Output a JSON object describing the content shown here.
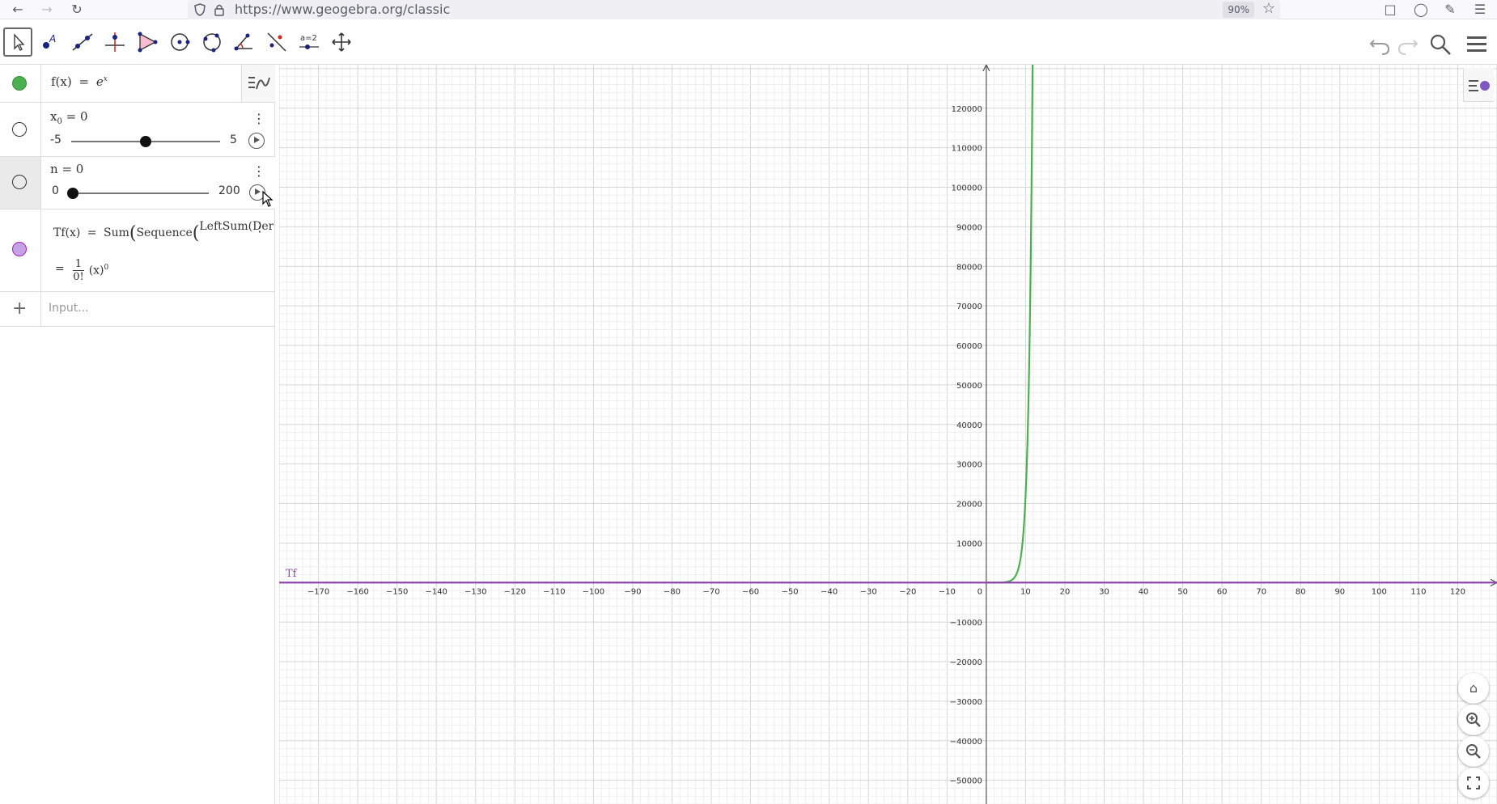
{
  "browser": {
    "url": "https://www.geogebra.org/classic",
    "zoom": "90%"
  },
  "toolbar": {
    "tools": [
      "move-tool",
      "point-tool",
      "line-tool",
      "perpendicular-tool",
      "polygon-tool",
      "circle-tool",
      "conic-tool",
      "angle-tool",
      "reflect-tool",
      "slider-tool",
      "move-graphics-tool"
    ],
    "slider_tool_label": "a=2"
  },
  "algebra": {
    "rows": [
      {
        "marble_color": "#4caf50",
        "name": "f(x)",
        "eq": "=",
        "base": "e",
        "exponent": "x"
      },
      {
        "var": "x",
        "sub": "0",
        "eq": "= 0",
        "min": "-5",
        "max": "5",
        "value": 0,
        "range": [
          -5,
          5
        ]
      },
      {
        "var": "n",
        "eq": "= 0",
        "min": "0",
        "max": "200",
        "value": 0,
        "range": [
          0,
          200
        ]
      },
      {
        "marble_color": "#c8a2e8",
        "name": "Tf(x)",
        "eq": "=",
        "fn1": "Sum",
        "fn2": "Sequence",
        "fn3": "LeftSum(Deriva",
        "eq2": "=",
        "num": "1",
        "den": "0!",
        "rest": "(x)",
        "rest_exp": "0"
      }
    ],
    "input_placeholder": "Input..."
  },
  "chart_data": {
    "type": "line",
    "x_ticks": [
      -170,
      -160,
      -150,
      -140,
      -130,
      -120,
      -110,
      -100,
      -90,
      -80,
      -70,
      -60,
      -50,
      -40,
      -30,
      -20,
      -10,
      0,
      10,
      20,
      30,
      40,
      50,
      60,
      70,
      80,
      90,
      100,
      110,
      120
    ],
    "y_ticks": [
      120000,
      110000,
      100000,
      90000,
      80000,
      70000,
      60000,
      50000,
      40000,
      30000,
      20000,
      10000,
      -10000,
      -20000,
      -30000,
      -40000,
      -50000
    ],
    "xlim": [
      -180,
      130
    ],
    "ylim": [
      -56000,
      131000
    ],
    "grid": true,
    "series": [
      {
        "name": "f",
        "color": "#4caf50",
        "function": "exp"
      },
      {
        "name": "Tf",
        "color": "#8e44ad",
        "function": "const1"
      }
    ],
    "series_label": "Tf",
    "series_label_color": "#8e44ad"
  }
}
